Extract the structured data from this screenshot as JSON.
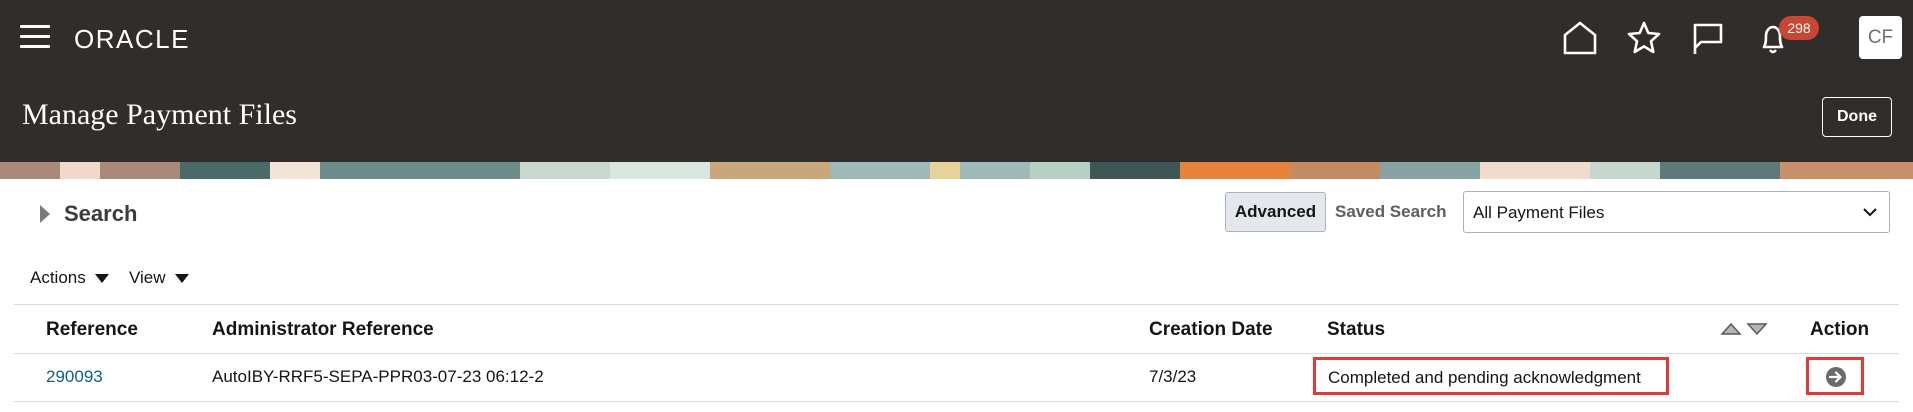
{
  "header": {
    "logo_text": "ORACLE",
    "notification_count": "298",
    "user_initials": "CF",
    "icons": [
      "menu-icon",
      "home-icon",
      "star-icon",
      "flag-icon",
      "bell-icon"
    ]
  },
  "page": {
    "title": "Manage Payment Files",
    "done_label": "Done"
  },
  "search": {
    "title": "Search",
    "advanced_label": "Advanced",
    "saved_search_label": "Saved Search",
    "saved_search_value": "All Payment Files"
  },
  "toolbar": {
    "actions_label": "Actions",
    "view_label": "View"
  },
  "table": {
    "columns": [
      "Reference",
      "Administrator Reference",
      "Creation Date",
      "Status",
      "Action"
    ],
    "rows": [
      {
        "reference": "290093",
        "admin_reference": "AutoIBY-RRF5-SEPA-PPR03-07-23 06:12-2",
        "creation_date": "7/3/23",
        "status": "Completed and pending acknowledgment"
      }
    ]
  },
  "colors": {
    "header_bg": "#312d2a",
    "link": "#0e6185",
    "badge": "#c74634",
    "highlight": "#e03a3a"
  }
}
